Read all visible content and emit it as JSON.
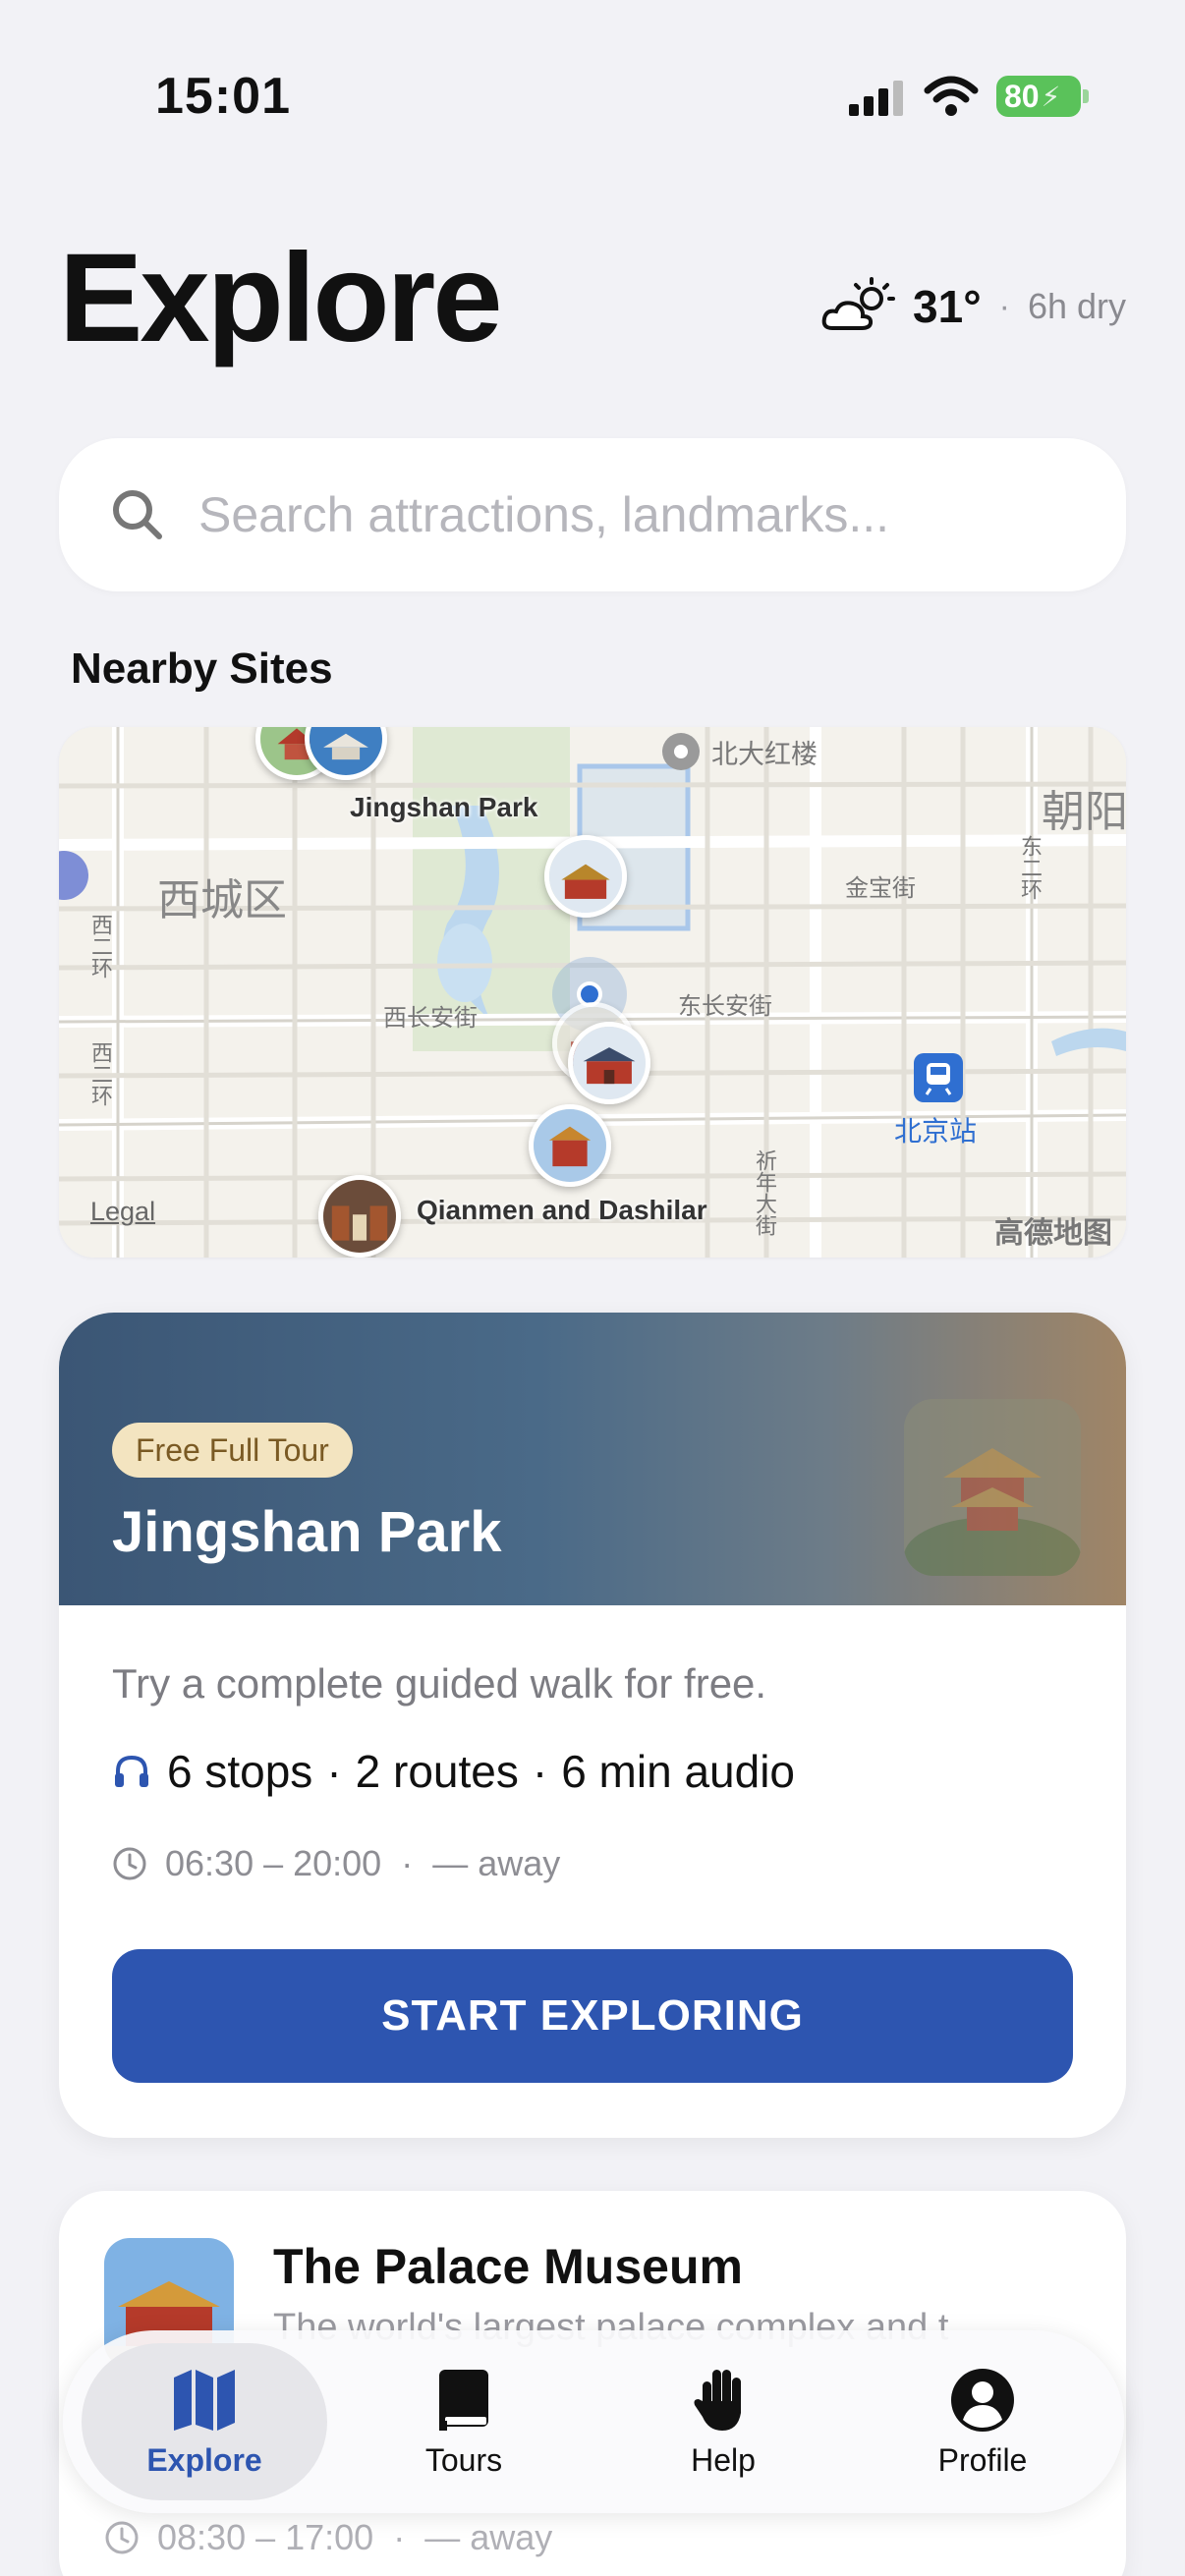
{
  "status_bar": {
    "time": "15:01",
    "battery": "80"
  },
  "header": {
    "title": "Explore",
    "temperature": "31°",
    "separator": "·",
    "weather_note": "6h dry"
  },
  "search": {
    "placeholder": "Search attractions, landmarks..."
  },
  "nearby": {
    "title": "Nearby Sites",
    "map": {
      "legal": "Legal",
      "attribution": "高德地图",
      "places": {
        "jingshan": "Jingshan Park",
        "qianmen": "Qianmen and Dashilar"
      },
      "labels": {
        "xicheng": "西城区",
        "chaoyang": "朝阳",
        "beida": "北大红楼",
        "jinbao": "金宝街",
        "xichangan": "西长安街",
        "dongchangan": "东长安街",
        "beijing_station": "北京站",
        "xierhuan_1": "西二环",
        "xierhuan_2": "西二环",
        "dongerhuan": "东二环",
        "qinian": "祈年大街"
      }
    }
  },
  "featured": {
    "tag": "Free Full Tour",
    "title": "Jingshan Park",
    "description": "Try a complete guided walk for free.",
    "stats": {
      "stops": "6 stops",
      "routes": "2 routes",
      "audio": "6 min audio",
      "sep": "·"
    },
    "hours": "06:30 – 20:00",
    "distance": "— away",
    "cta": "START EXPLORING"
  },
  "second": {
    "title": "The Palace Museum",
    "description": "The world's largest palace complex and t",
    "hours": "08:30 – 17:00",
    "distance": "— away"
  },
  "tabs": [
    {
      "label": "Explore",
      "icon": "map-icon",
      "active": true
    },
    {
      "label": "Tours",
      "icon": "book-icon"
    },
    {
      "label": "Help",
      "icon": "hand-icon"
    },
    {
      "label": "Profile",
      "icon": "profile-icon"
    }
  ],
  "colors": {
    "accent": "#2d55b0",
    "tag_bg": "#f3e4c0",
    "battery": "#5ac25a"
  }
}
